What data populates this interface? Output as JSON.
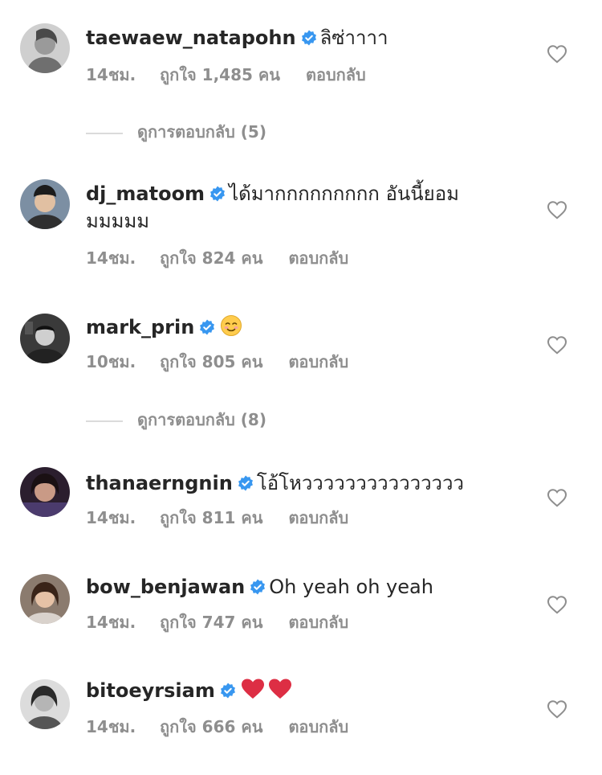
{
  "ui": {
    "time_suffix": "ชม.",
    "likes_prefix": "ถูกใจ",
    "likes_suffix": "คน",
    "reply_label": "ตอบกลับ",
    "view_replies_prefix": "ดูการตอบกลับ",
    "verified_icon": "verified-badge-icon",
    "like_icon": "heart-outline-icon",
    "accent_color": "#3897f0",
    "meta_color": "#8e8e8e"
  },
  "comments": [
    {
      "username": "taewaew_natapohn",
      "text": "ลิซ่าาาา",
      "time": "14ชม.",
      "likes": "ถูกใจ 1,485 คน",
      "reply": "ตอบกลับ",
      "view_replies": "ดูการตอบกลับ (5)"
    },
    {
      "username": "dj_matoom",
      "text_line1": "ได้มากกกกกกกกก อันนี้ยอม",
      "text_line2": "มมมมม",
      "time": "14ชม.",
      "likes": "ถูกใจ 824 คน",
      "reply": "ตอบกลับ"
    },
    {
      "username": "mark_prin",
      "text_emoji": "smiling-face-emoji",
      "time": "10ชม.",
      "likes": "ถูกใจ 805 คน",
      "reply": "ตอบกลับ",
      "view_replies": "ดูการตอบกลับ (8)"
    },
    {
      "username": "thanaerngnin",
      "text": "โอ้โหววววววววววววววว",
      "time": "14ชม.",
      "likes": "ถูกใจ 811 คน",
      "reply": "ตอบกลับ"
    },
    {
      "username": "bow_benjawan",
      "text": "Oh yeah oh yeah",
      "time": "14ชม.",
      "likes": "ถูกใจ 747 คน",
      "reply": "ตอบกลับ"
    },
    {
      "username": "bitoeyrsiam",
      "text_emoji": "two-red-hearts-emoji",
      "time": "14ชม.",
      "likes": "ถูกใจ 666 คน",
      "reply": "ตอบกลับ"
    }
  ]
}
